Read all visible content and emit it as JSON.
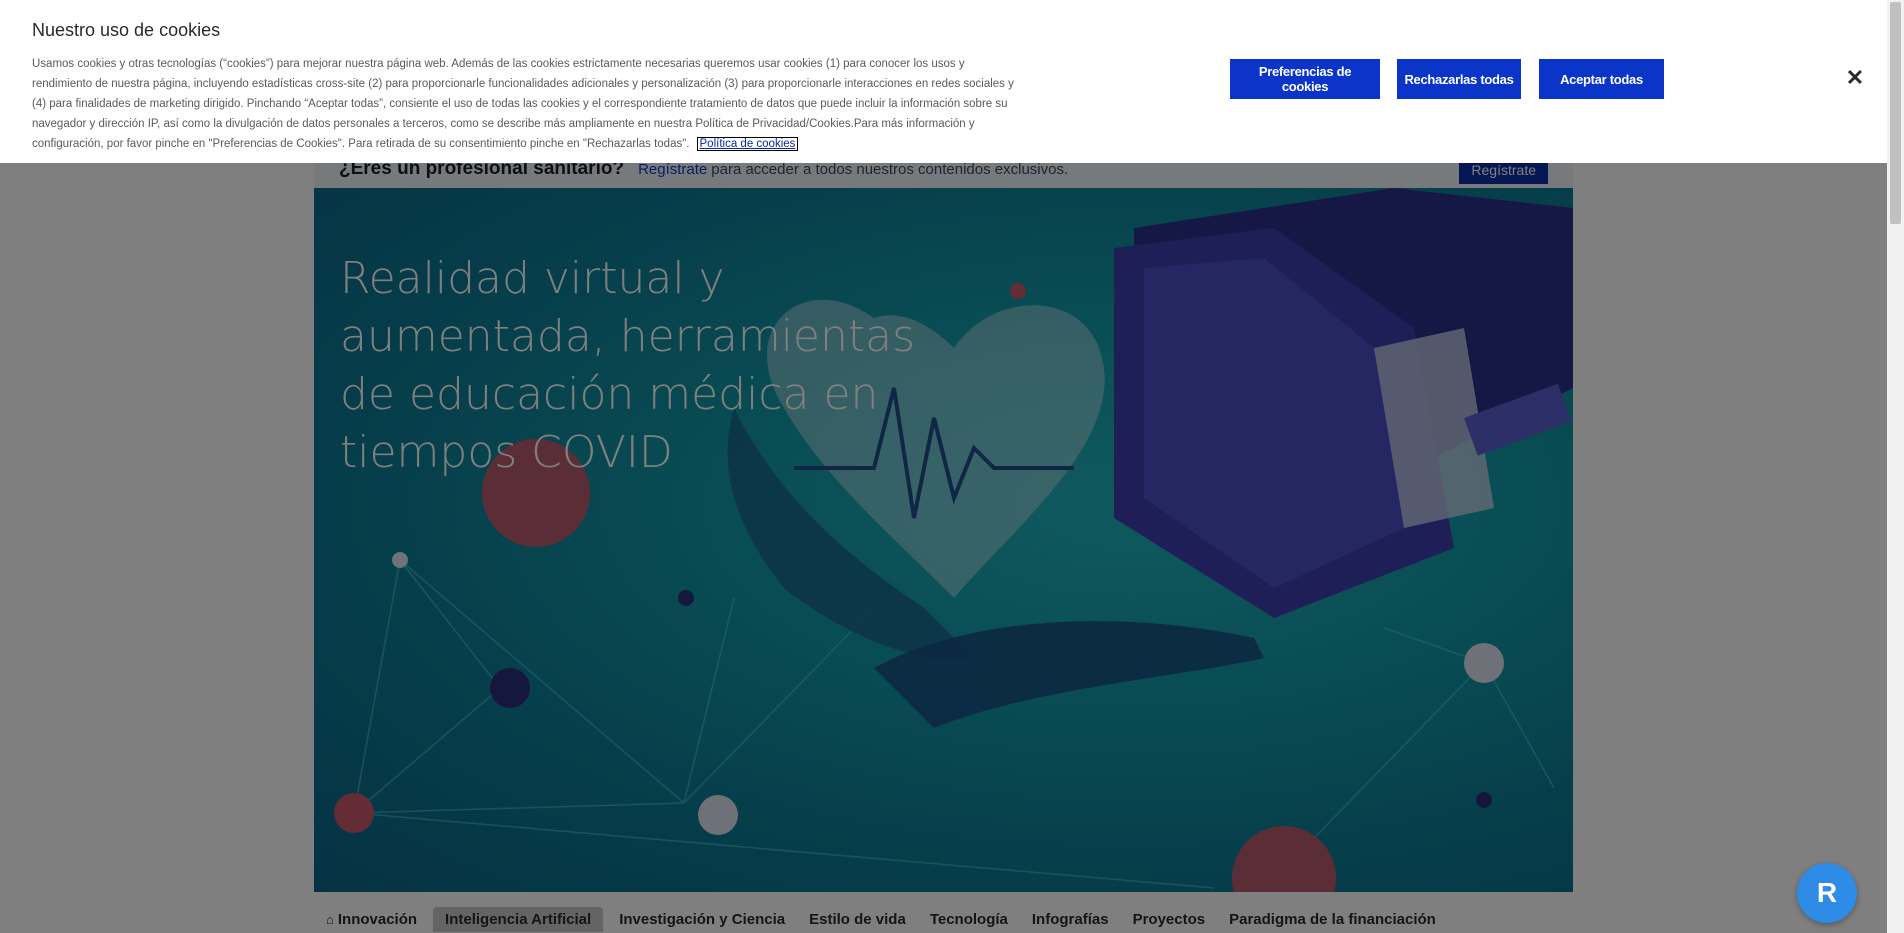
{
  "pro_bar": {
    "title": "¿Eres un profesional sanitario?",
    "link": "Regístrate",
    "rest": "para acceder a todos nuestros contenidos exclusivos.",
    "button": "Regístrate"
  },
  "hero": {
    "title": "Realidad virtual y aumentada, herramientas de educación médica en tiempos COVID"
  },
  "nav": {
    "items": [
      {
        "label": "Innovación",
        "icon": "home-icon"
      },
      {
        "label": "Inteligencia Artificial",
        "active": true
      },
      {
        "label": "Investigación y Ciencia"
      },
      {
        "label": "Estilo de vida"
      },
      {
        "label": "Tecnología"
      },
      {
        "label": "Infografías"
      },
      {
        "label": "Proyectos"
      },
      {
        "label": "Paradigma de la financiación"
      }
    ]
  },
  "cookie": {
    "title": "Nuestro uso de cookies",
    "text": "Usamos cookies y otras tecnologías (“cookies”) para mejorar nuestra página web. Además de las cookies estrictamente necesarias queremos usar cookies (1) para conocer los usos y rendimiento de nuestra página, incluyendo estadísticas cross-site (2) para proporcionarle funcionalidades adicionales y personalización (3) para proporcionarle interacciones en redes sociales y (4) para finalidades de marketing dirigido. Pinchando “Aceptar todas”, consiente el uso de todas las cookies y el correspondiente tratamiento de datos que puede incluir la información sobre su navegador y dirección IP, así como la divulgación de datos personales a terceros, como se describe más ampliamente en nuestra Política de Privacidad/Cookies.Para más información y configuración, por favor pinche en \"Preferencias de Cookies\". Para retirada de su consentimiento pinche en \"Rechazarlas todas\".",
    "policy_link": "Política de cookies",
    "btn_prefs": "Preferencias de cookies",
    "btn_reject": "Rechazarlas todas",
    "btn_accept": "Aceptar todas",
    "close": "✕"
  },
  "fab": {
    "icon": "assistant-icon",
    "glyph": "R"
  },
  "colors": {
    "accent": "#0b34c9",
    "hero": "#129aa8"
  }
}
